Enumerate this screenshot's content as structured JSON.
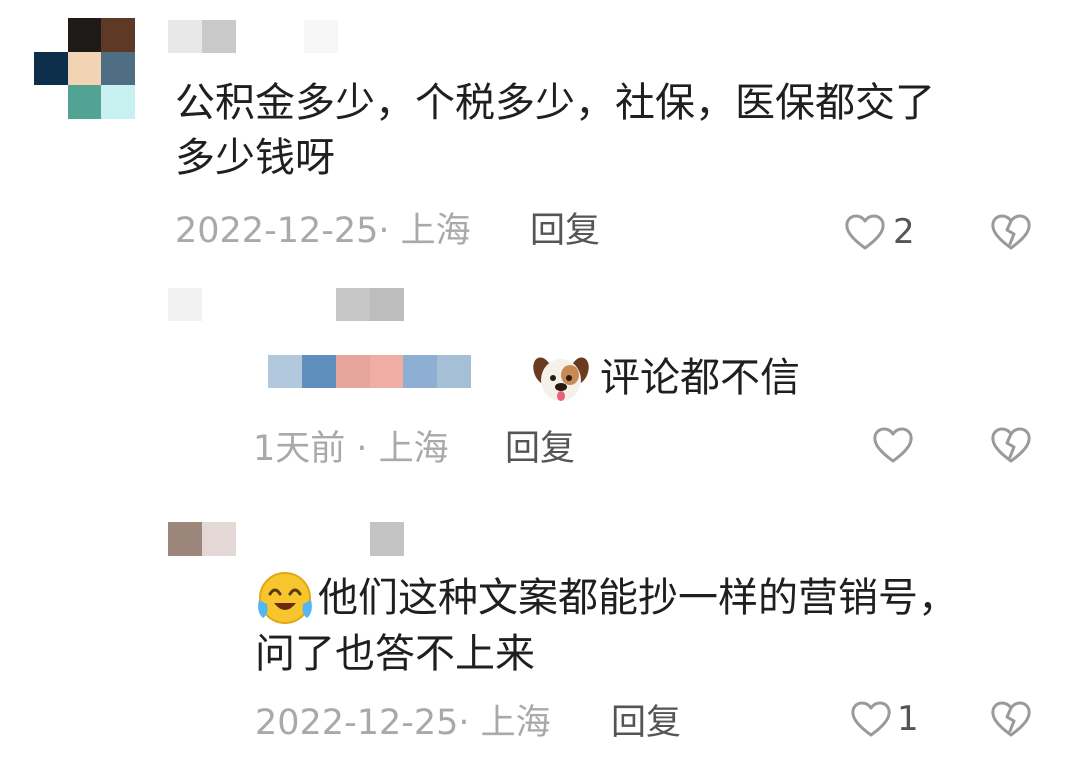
{
  "colors": {
    "text": "#1f1f1f",
    "meta": "#a9a9a9",
    "reply": "#555555",
    "icon": "#9a9a9a"
  },
  "comments": [
    {
      "text_lines": [
        "公积金多少，个税多少，社保，医保都交了",
        "多少钱呀"
      ],
      "meta": "2022-12-25· 上海",
      "reply_label": "回复",
      "like_count": "2",
      "like_icon": "heart-outline-icon",
      "dislike_icon": "broken-heart-icon"
    }
  ],
  "replies": [
    {
      "emoji": "dog-face-emoji",
      "text_lines": [
        "评论都不信"
      ],
      "meta": "1天前 · 上海",
      "reply_label": "回复",
      "like_count": "",
      "like_icon": "heart-outline-icon",
      "dislike_icon": "broken-heart-icon"
    },
    {
      "emoji": "crying-laughing-emoji",
      "text_lines": [
        "他们这种文案都能抄一样的营销号，",
        "问了也答不上来"
      ],
      "meta": "2022-12-25· 上海",
      "reply_label": "回复",
      "like_count": "1",
      "like_icon": "heart-outline-icon",
      "dislike_icon": "broken-heart-icon"
    }
  ]
}
